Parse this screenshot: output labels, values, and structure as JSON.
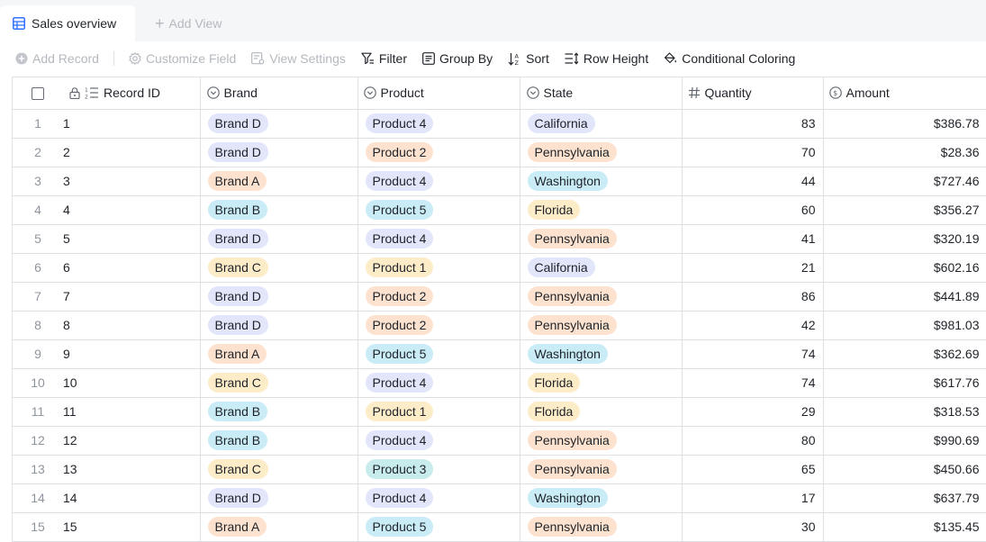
{
  "tabs": {
    "active_label": "Sales overview",
    "add_view_label": "Add View"
  },
  "toolbar": {
    "add_record": "Add Record",
    "customize_field": "Customize Field",
    "view_settings": "View Settings",
    "filter": "Filter",
    "group_by": "Group By",
    "sort": "Sort",
    "row_height": "Row Height",
    "conditional_coloring": "Conditional Coloring"
  },
  "columns": {
    "record_id": "Record ID",
    "brand": "Brand",
    "product": "Product",
    "state": "State",
    "quantity": "Quantity",
    "amount": "Amount"
  },
  "tag_colors": {
    "Brand A": "#fde3cf",
    "Brand B": "#c9ecf7",
    "Brand C": "#fdecc8",
    "Brand D": "#e1e6fb",
    "Product 1": "#fdecc8",
    "Product 2": "#fde3cf",
    "Product 3": "#c8ecec",
    "Product 4": "#e1e6fb",
    "Product 5": "#c9ecf7",
    "California": "#e1e6fb",
    "Pennsylvania": "#fde3cf",
    "Washington": "#c9ecf7",
    "Florida": "#fdecc8"
  },
  "rows": [
    {
      "n": "1",
      "id": "1",
      "brand": "Brand D",
      "product": "Product 4",
      "state": "California",
      "quantity": "83",
      "amount": "$386.78"
    },
    {
      "n": "2",
      "id": "2",
      "brand": "Brand D",
      "product": "Product 2",
      "state": "Pennsylvania",
      "quantity": "70",
      "amount": "$28.36"
    },
    {
      "n": "3",
      "id": "3",
      "brand": "Brand A",
      "product": "Product 4",
      "state": "Washington",
      "quantity": "44",
      "amount": "$727.46"
    },
    {
      "n": "4",
      "id": "4",
      "brand": "Brand B",
      "product": "Product 5",
      "state": "Florida",
      "quantity": "60",
      "amount": "$356.27"
    },
    {
      "n": "5",
      "id": "5",
      "brand": "Brand D",
      "product": "Product 4",
      "state": "Pennsylvania",
      "quantity": "41",
      "amount": "$320.19"
    },
    {
      "n": "6",
      "id": "6",
      "brand": "Brand C",
      "product": "Product 1",
      "state": "California",
      "quantity": "21",
      "amount": "$602.16"
    },
    {
      "n": "7",
      "id": "7",
      "brand": "Brand D",
      "product": "Product 2",
      "state": "Pennsylvania",
      "quantity": "86",
      "amount": "$441.89"
    },
    {
      "n": "8",
      "id": "8",
      "brand": "Brand D",
      "product": "Product 2",
      "state": "Pennsylvania",
      "quantity": "42",
      "amount": "$981.03"
    },
    {
      "n": "9",
      "id": "9",
      "brand": "Brand A",
      "product": "Product 5",
      "state": "Washington",
      "quantity": "74",
      "amount": "$362.69"
    },
    {
      "n": "10",
      "id": "10",
      "brand": "Brand C",
      "product": "Product 4",
      "state": "Florida",
      "quantity": "74",
      "amount": "$617.76"
    },
    {
      "n": "11",
      "id": "11",
      "brand": "Brand B",
      "product": "Product 1",
      "state": "Florida",
      "quantity": "29",
      "amount": "$318.53"
    },
    {
      "n": "12",
      "id": "12",
      "brand": "Brand B",
      "product": "Product 4",
      "state": "Pennsylvania",
      "quantity": "80",
      "amount": "$990.69"
    },
    {
      "n": "13",
      "id": "13",
      "brand": "Brand C",
      "product": "Product 3",
      "state": "Pennsylvania",
      "quantity": "65",
      "amount": "$450.66"
    },
    {
      "n": "14",
      "id": "14",
      "brand": "Brand D",
      "product": "Product 4",
      "state": "Washington",
      "quantity": "17",
      "amount": "$637.79"
    },
    {
      "n": "15",
      "id": "15",
      "brand": "Brand A",
      "product": "Product 5",
      "state": "Pennsylvania",
      "quantity": "30",
      "amount": "$135.45"
    }
  ]
}
